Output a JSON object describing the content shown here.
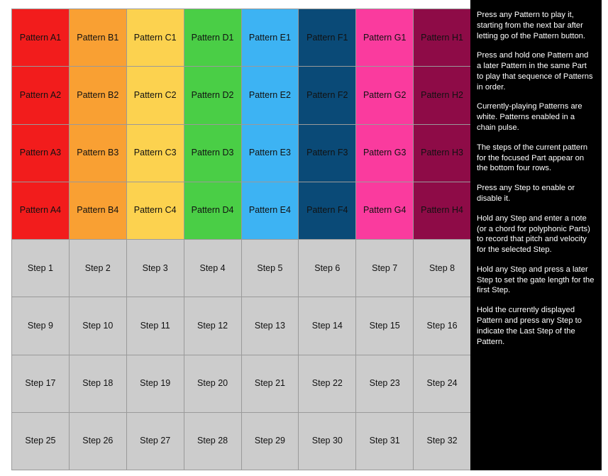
{
  "grid": {
    "columns": 8,
    "rows": 8,
    "pattern_rows": 4,
    "step_rows": 4,
    "column_colors": [
      "#F21C1C",
      "#F9A033",
      "#FCD24F",
      "#4ACE46",
      "#3DB3F3",
      "#0A4A77",
      "#FA3B9E",
      "#8E0B47"
    ],
    "step_color": "#CCCCCC",
    "border_color": "#9A9A9A",
    "label_color": "#111111",
    "pattern_rows_labels": [
      [
        "Pattern A1",
        "Pattern B1",
        "Pattern C1",
        "Pattern D1",
        "Pattern E1",
        "Pattern F1",
        "Pattern G1",
        "Pattern H1"
      ],
      [
        "Pattern A2",
        "Pattern B2",
        "Pattern C2",
        "Pattern D2",
        "Pattern E2",
        "Pattern F2",
        "Pattern G2",
        "Pattern H2"
      ],
      [
        "Pattern A3",
        "Pattern B3",
        "Pattern C3",
        "Pattern D3",
        "Pattern E3",
        "Pattern F3",
        "Pattern G3",
        "Pattern H3"
      ],
      [
        "Pattern A4",
        "Pattern B4",
        "Pattern C4",
        "Pattern D4",
        "Pattern E4",
        "Pattern F4",
        "Pattern G4",
        "Pattern H4"
      ]
    ],
    "step_rows_labels": [
      [
        "Step 1",
        "Step 2",
        "Step 3",
        "Step 4",
        "Step 5",
        "Step 6",
        "Step 7",
        "Step 8"
      ],
      [
        "Step 9",
        "Step 10",
        "Step 11",
        "Step 12",
        "Step 13",
        "Step 14",
        "Step 15",
        "Step 16"
      ],
      [
        "Step 17",
        "Step 18",
        "Step 19",
        "Step 20",
        "Step 21",
        "Step 22",
        "Step 23",
        "Step 24"
      ],
      [
        "Step 25",
        "Step 26",
        "Step 27",
        "Step 28",
        "Step 29",
        "Step 30",
        "Step 31",
        "Step 32"
      ]
    ]
  },
  "help_panel": {
    "background": "#000000",
    "text_color": "#FFFFFF",
    "paragraphs": [
      "Press any Pattern to play it, starting from the next bar after letting go of the Pattern button.",
      "Press and hold one Pattern and a later Pattern in the same Part to play that sequence of Patterns in order.",
      "Currently-playing Patterns are white. Patterns enabled in a chain pulse.",
      "The steps of the current pattern for the focused Part appear on the bottom four rows.",
      "Press any Step to enable or disable it.",
      "Hold any Step and enter a note (or a chord for polyphonic Parts) to record that pitch and velocity for the selected Step.",
      "Hold any Step and press a later Step to set the gate length for the first Step.",
      "Hold the currently displayed Pattern and press any Step to indicate the Last Step of the Pattern."
    ]
  }
}
